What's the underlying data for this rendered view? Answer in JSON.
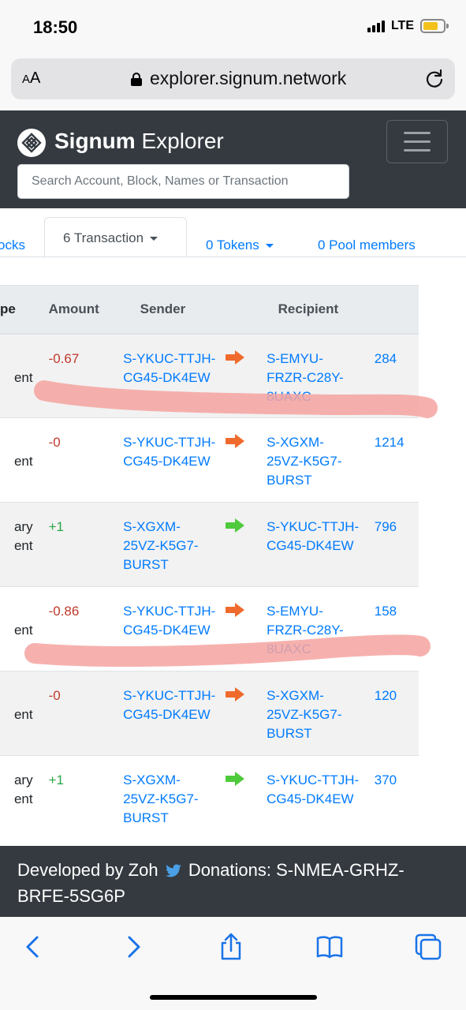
{
  "status_bar": {
    "time": "18:50",
    "network": "LTE"
  },
  "browser": {
    "text_size_label": "AA",
    "url": "explorer.signum.network"
  },
  "navbar": {
    "brand_bold": "Signum",
    "brand_light": "Explorer",
    "search_placeholder": "Search Account, Block, Names or Transaction"
  },
  "tabs": [
    {
      "label": "ocks"
    },
    {
      "label": "6 Transaction"
    },
    {
      "label": "0 Tokens"
    },
    {
      "label": "0 Pool members"
    }
  ],
  "table": {
    "headers": {
      "type": "pe",
      "amount": "Amount",
      "sender": "Sender",
      "recipient": "Recipient"
    },
    "rows": [
      {
        "type": "ent",
        "amount": "-0.67",
        "sign": "neg",
        "sender": [
          "S-YKUC-TTJH-",
          "CG45-DK4EW"
        ],
        "direction": "out",
        "recipient": [
          "S-EMYU-",
          "FRZR-C28Y-",
          "8UAXC"
        ],
        "extra": "284"
      },
      {
        "type": "ent",
        "amount": "-0",
        "sign": "neg",
        "sender": [
          "S-YKUC-TTJH-",
          "CG45-DK4EW"
        ],
        "direction": "out",
        "recipient": [
          "S-XGXM-",
          "25VZ-K5G7-",
          "BURST"
        ],
        "extra": "1214"
      },
      {
        "type": [
          "ary",
          "ent"
        ],
        "amount": "+1",
        "sign": "pos",
        "sender": [
          "S-XGXM-",
          "25VZ-K5G7-",
          "BURST"
        ],
        "direction": "in",
        "recipient": [
          "S-YKUC-TTJH-",
          "CG45-DK4EW"
        ],
        "extra": "796"
      },
      {
        "type": "ent",
        "amount": "-0.86",
        "sign": "neg",
        "sender": [
          "S-YKUC-TTJH-",
          "CG45-DK4EW"
        ],
        "direction": "out",
        "recipient": [
          "S-EMYU-",
          "FRZR-C28Y-",
          "8UAXC"
        ],
        "extra": "158"
      },
      {
        "type": "ent",
        "amount": "-0",
        "sign": "neg",
        "sender": [
          "S-YKUC-TTJH-",
          "CG45-DK4EW"
        ],
        "direction": "out",
        "recipient": [
          "S-XGXM-",
          "25VZ-K5G7-",
          "BURST"
        ],
        "extra": "120"
      },
      {
        "type": [
          "ary",
          "ent"
        ],
        "amount": "+1",
        "sign": "pos",
        "sender": [
          "S-XGXM-",
          "25VZ-K5G7-",
          "BURST"
        ],
        "direction": "in",
        "recipient": [
          "S-YKUC-TTJH-",
          "CG45-DK4EW"
        ],
        "extra": "370"
      }
    ]
  },
  "footer": {
    "developed_by": "Developed by Zoh",
    "donations": "Donations: S-NMEA-GRHZ-BRFE-5SG6P"
  },
  "colors": {
    "navbar": "#343a40",
    "link": "#007bff",
    "negative": "#c0392b",
    "positive": "#28a745",
    "arrow_out": "#ef6a2c",
    "arrow_in": "#4fca3c",
    "highlight": "#f4a3a0"
  },
  "icons": [
    "signal-icon",
    "battery-icon",
    "lock-icon",
    "reload-icon",
    "signum-logo-icon",
    "menu-icon",
    "caret-down-icon",
    "arrow-right-icon",
    "twitter-icon",
    "back-icon",
    "forward-icon",
    "share-icon",
    "bookmarks-icon",
    "tabs-icon"
  ]
}
